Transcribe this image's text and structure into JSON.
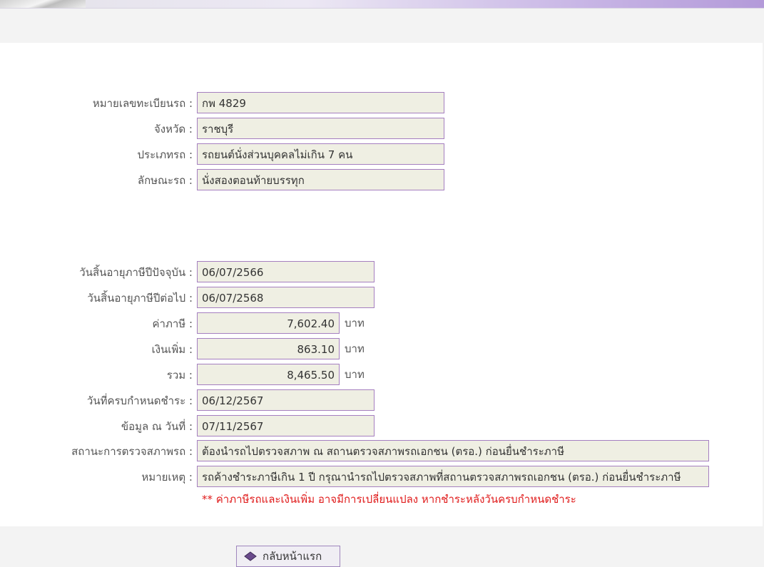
{
  "vehicle": {
    "plate_label": "หมายเลขทะเบียนรถ :",
    "plate_value": "กพ 4829",
    "province_label": "จังหวัด :",
    "province_value": "ราชบุรี",
    "type_label": "ประเภทรถ :",
    "type_value": "รถยนต์นั่งส่วนบุคคลไม่เกิน 7 คน",
    "body_label": "ลักษณะรถ :",
    "body_value": "นั่งสองตอนท้ายบรรทุก"
  },
  "tax": {
    "current_expiry_label": "วันสิ้นอายุภาษีปีปัจจุบัน :",
    "current_expiry_value": "06/07/2566",
    "next_expiry_label": "วันสิ้นอายุภาษีปีต่อไป :",
    "next_expiry_value": "06/07/2568",
    "tax_label": "ค่าภาษี :",
    "tax_value": "7,602.40",
    "surcharge_label": "เงินเพิ่ม :",
    "surcharge_value": "863.10",
    "total_label": "รวม :",
    "total_value": "8,465.50",
    "unit": "บาท",
    "due_label": "วันที่ครบกำหนดชำระ :",
    "due_value": "06/12/2567",
    "asof_label": "ข้อมูล ณ วันที่ :",
    "asof_value": "07/11/2567",
    "inspection_label": "สถานะการตรวจสภาพรถ :",
    "inspection_value": "ต้องนำรถไปตรวจสภาพ ณ สถานตรวจสภาพรถเอกชน (ตรอ.) ก่อนยื่นชำระภาษี",
    "remark_label": "หมายเหตุ :",
    "remark_value": "รถค้างชำระภาษีเกิน 1 ปี กรุณานำรถไปตรวจสภาพที่สถานตรวจสภาพรถเอกชน (ตรอ.) ก่อนยื่นชำระภาษี",
    "note": "** ค่าภาษีรถและเงินเพิ่ม อาจมีการเปลี่ยนแปลง หากชำระหลังวันครบกำหนดชำระ"
  },
  "nav": {
    "back_label": "กลับหน้าแรก"
  },
  "colors": {
    "field_bg": "#efefe3",
    "field_border": "#a57fc0",
    "note_red": "#e01b1b"
  }
}
